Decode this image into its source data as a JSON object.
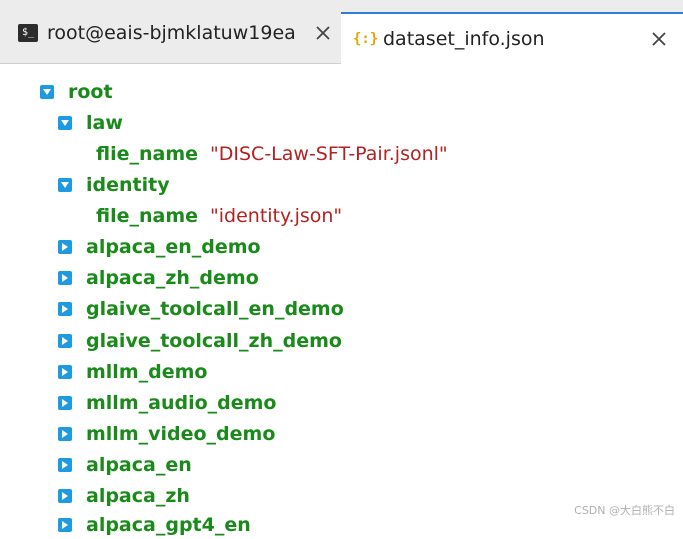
{
  "tabs": [
    {
      "label": "root@eais-bjmklatuw19ea",
      "icon": "terminal-icon",
      "active": false
    },
    {
      "label": "dataset_info.json",
      "icon": "json-file-icon",
      "active": true
    }
  ],
  "tree": {
    "root_label": "root",
    "law": {
      "key": "law",
      "prop_key": "flie_name",
      "prop_value": "\"DISC-Law-SFT-Pair.jsonl\""
    },
    "identity": {
      "key": "identity",
      "prop_key": "file_name",
      "prop_value": "\"identity.json\""
    },
    "collapsed": [
      "alpaca_en_demo",
      "alpaca_zh_demo",
      "glaive_toolcall_en_demo",
      "glaive_toolcall_zh_demo",
      "mllm_demo",
      "mllm_audio_demo",
      "mllm_video_demo",
      "alpaca_en",
      "alpaca_zh",
      "alpaca_gpt4_en"
    ]
  },
  "watermark": "CSDN @大白熊不白",
  "colors": {
    "key": "#1a8a1a",
    "value": "#b22222",
    "toggle": "#1e9be0",
    "active_tab_accent": "#2f7ed8"
  }
}
